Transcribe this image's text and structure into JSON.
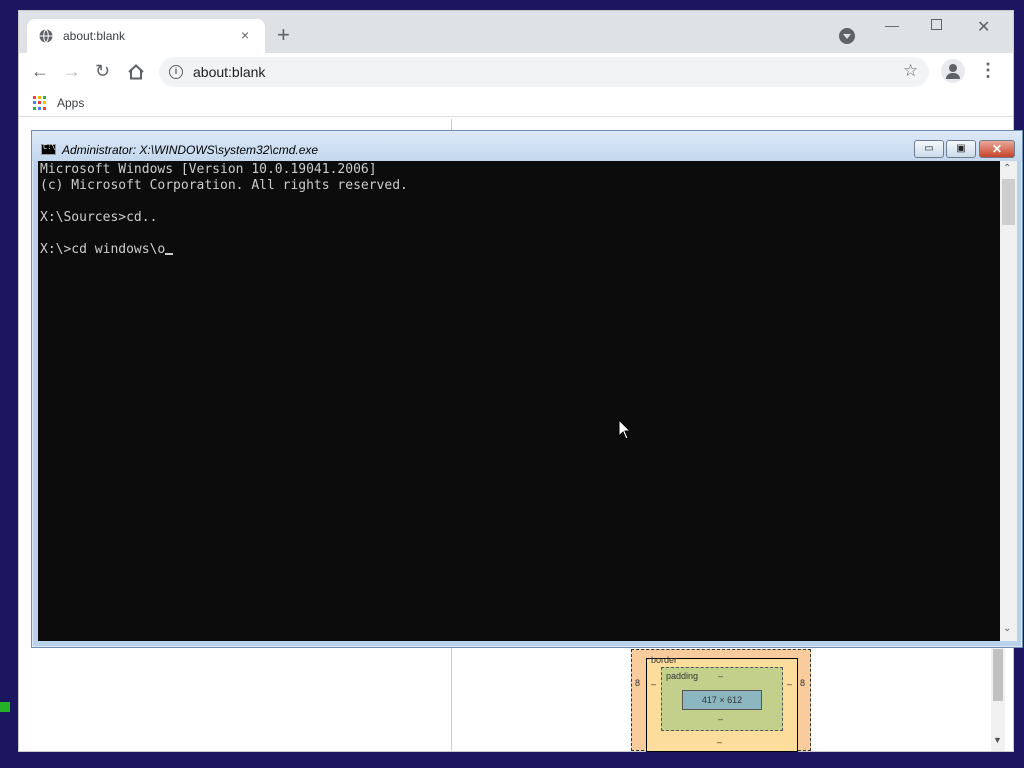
{
  "browser": {
    "tab_title": "about:blank",
    "tab_close": "×",
    "new_tab": "+",
    "url": "about:blank",
    "apps_label": "Apps",
    "win_min": "—",
    "win_close": "✕"
  },
  "devtools": {
    "boxmodel": {
      "border_label": "border",
      "padding_label": "padding",
      "padding_top": "–",
      "padding_bottom": "–",
      "padding_left": "–",
      "padding_right": "–",
      "border_left": "8",
      "border_right": "8",
      "margin_bottom": "–",
      "content_size": "417 × 612"
    }
  },
  "cmd": {
    "title": "Administrator: X:\\WINDOWS\\system32\\cmd.exe",
    "icon_text": "C:\\",
    "btn_min": "▭",
    "btn_max": "▣",
    "btn_close": "✕",
    "lines": [
      "Microsoft Windows [Version 10.0.19041.2006]",
      "(c) Microsoft Corporation. All rights reserved.",
      "",
      "X:\\Sources>cd..",
      "",
      "X:\\>cd windows\\o"
    ]
  },
  "colors": {
    "desktop": "#1c1560",
    "console_bg": "#0c0c0c",
    "console_fg": "#cccccc",
    "apps_dots": [
      "#ea4335",
      "#fbbc05",
      "#34a853",
      "#4285f4",
      "#ea4335",
      "#fbbc05",
      "#34a853",
      "#4285f4",
      "#ea4335"
    ]
  }
}
